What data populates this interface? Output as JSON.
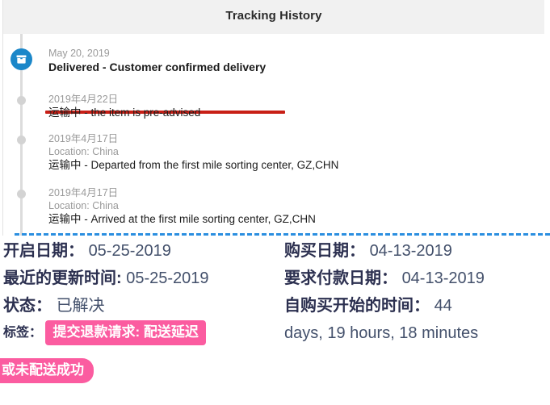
{
  "tracking": {
    "header_title": "Tracking History",
    "package_icon": "package-box-icon",
    "events": [
      {
        "date": "May 20, 2019",
        "location": "",
        "description": "Delivered - Customer confirmed delivery",
        "current": true
      },
      {
        "date": "2019年4月22日",
        "location": "",
        "description": "运输中 - the item is pre-advised",
        "current": false
      },
      {
        "date": "2019年4月17日",
        "location": "Location: China",
        "description": "运输中 - Departed from the first mile sorting center, GZ,CHN",
        "current": false
      },
      {
        "date": "2019年4月17日",
        "location": "Location: China",
        "description": "运输中 - Arrived at the first mile sorting center, GZ,CHN",
        "current": false
      }
    ],
    "highlight_color": "#c81f16"
  },
  "details": {
    "left": [
      {
        "label": "开启日期：",
        "value": "05-25-2019"
      },
      {
        "label": "最近的更新时间:",
        "value": "05-25-2019"
      },
      {
        "label": "状态：",
        "value": "已解决"
      }
    ],
    "tag_label": "标签：",
    "tag_badge_line1": "提交退款请求: 配送延迟",
    "tag_badge_line2": "或未配送成功",
    "badge_color": "#fb5ca0",
    "right": [
      {
        "label": "购买日期：",
        "value": "04-13-2019"
      },
      {
        "label": "要求付款日期：",
        "value": "04-13-2019"
      },
      {
        "label": "自购买开始的时间：",
        "value": "44"
      }
    ],
    "right_overflow": "days, 19 hours, 18 minutes"
  }
}
